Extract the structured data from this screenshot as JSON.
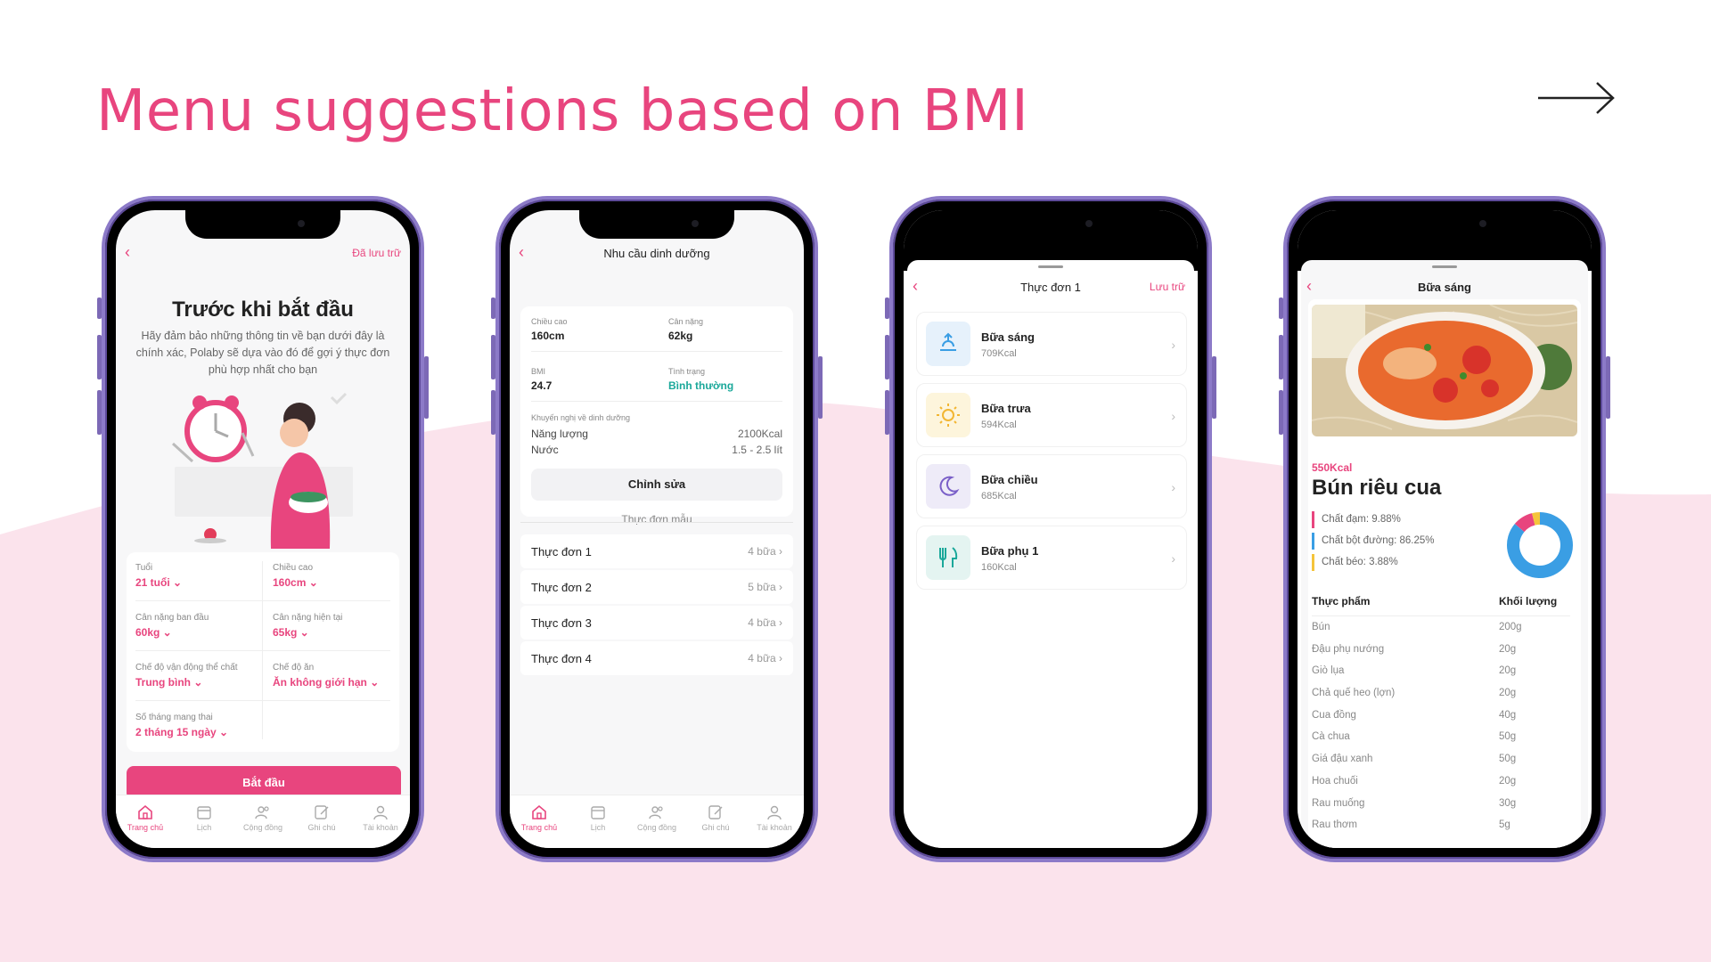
{
  "slide": {
    "title": "Menu suggestions based on BMI",
    "accent": "#e8457e"
  },
  "screen1": {
    "saved_label": "Đã lưu trữ",
    "heading": "Trước khi bắt đầu",
    "subtitle": "Hãy đảm bảo những thông tin về bạn dưới đây là chính xác, Polaby sẽ dựa vào đó để gợi ý thực đơn phù hợp nhất cho bạn",
    "fields": [
      {
        "label": "Tuổi",
        "value": "21 tuổi ⌄"
      },
      {
        "label": "Chiều cao",
        "value": "160cm ⌄"
      },
      {
        "label": "Cân nặng ban đầu",
        "value": "60kg ⌄"
      },
      {
        "label": "Cân nặng hiện tại",
        "value": "65kg ⌄"
      },
      {
        "label": "Chế độ vận động thể chất",
        "value": "Trung bình ⌄"
      },
      {
        "label": "Chế độ ăn",
        "value": "Ăn không giới hạn ⌄"
      },
      {
        "label": "Số tháng mang thai",
        "value": "2 tháng 15 ngày ⌄"
      }
    ],
    "start_button": "Bắt đầu"
  },
  "tabs": [
    "Trang chủ",
    "Lịch",
    "Cộng đồng",
    "Ghi chú",
    "Tài khoản"
  ],
  "screen2": {
    "title": "Nhu cầu dinh dưỡng",
    "height_label": "Chiều cao",
    "height_value": "160cm",
    "weight_label": "Cân nặng",
    "weight_value": "62kg",
    "bmi_label": "BMI",
    "bmi_value": "24.7",
    "status_label": "Tình trạng",
    "status_value": "Bình thường",
    "advice_label": "Khuyến nghị về dinh dưỡng",
    "energy_label": "Năng lượng",
    "energy_value": "2100Kcal",
    "water_label": "Nước",
    "water_value": "1.5 - 2.5 lít",
    "edit_button": "Chỉnh sửa",
    "section_label": "Thực đơn mẫu",
    "menus": [
      {
        "name": "Thực đơn 1",
        "meals": "4 bữa"
      },
      {
        "name": "Thực đơn 2",
        "meals": "5 bữa"
      },
      {
        "name": "Thực đơn 3",
        "meals": "4 bữa"
      },
      {
        "name": "Thực đơn 4",
        "meals": "4 bữa"
      }
    ]
  },
  "screen3": {
    "title": "Thực đơn 1",
    "save_label": "Lưu trữ",
    "meals": [
      {
        "name": "Bữa sáng",
        "kcal": "709Kcal",
        "icon": "sunrise-icon",
        "color": "#e6f1fb"
      },
      {
        "name": "Bữa trưa",
        "kcal": "594Kcal",
        "icon": "sun-icon",
        "color": "#fdf5dc"
      },
      {
        "name": "Bữa chiều",
        "kcal": "685Kcal",
        "icon": "moon-icon",
        "color": "#eeebf8"
      },
      {
        "name": "Bữa phụ 1",
        "kcal": "160Kcal",
        "icon": "fork-knife-icon",
        "color": "#e4f4f1"
      }
    ]
  },
  "screen4": {
    "title": "Bữa sáng",
    "kcal": "550Kcal",
    "dish": "Bún riêu cua",
    "protein": "Chất đạm: 9.88%",
    "carbs": "Chất bột đường: 86.25%",
    "fat": "Chất béo: 3.88%",
    "col_food": "Thực phẩm",
    "col_weight": "Khối lượng",
    "ingredients": [
      {
        "name": "Bún",
        "weight": "200g"
      },
      {
        "name": "Đậu phụ nướng",
        "weight": "20g"
      },
      {
        "name": "Giò lụa",
        "weight": "20g"
      },
      {
        "name": "Chả quế heo (lợn)",
        "weight": "20g"
      },
      {
        "name": "Cua đồng",
        "weight": "40g"
      },
      {
        "name": "Cà chua",
        "weight": "50g"
      },
      {
        "name": "Giá đậu xanh",
        "weight": "50g"
      },
      {
        "name": "Hoa chuối",
        "weight": "20g"
      },
      {
        "name": "Rau muống",
        "weight": "30g"
      },
      {
        "name": "Rau thơm",
        "weight": "5g"
      }
    ],
    "macro_colors": {
      "protein": "#e8457e",
      "carbs": "#3a9ee4",
      "fat": "#f5c43b"
    }
  }
}
